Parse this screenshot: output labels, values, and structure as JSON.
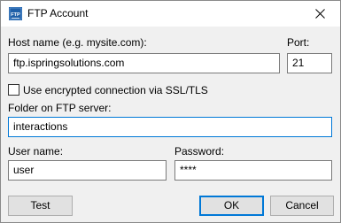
{
  "window": {
    "title": "FTP Account",
    "icon_text": "FTP"
  },
  "form": {
    "host_label": "Host name (e.g. mysite.com):",
    "host_value": "ftp.ispringsolutions.com",
    "port_label": "Port:",
    "port_value": "21",
    "ssl_label": "Use encrypted connection via SSL/TLS",
    "ssl_checked": false,
    "folder_label": "Folder on FTP server:",
    "folder_value": "interactions",
    "user_label": "User name:",
    "user_value": "user",
    "password_label": "Password:",
    "password_value": "****"
  },
  "buttons": {
    "test": "Test",
    "ok": "OK",
    "cancel": "Cancel"
  },
  "colors": {
    "accent": "#0078d7",
    "icon_blue": "#1e5fa8"
  }
}
